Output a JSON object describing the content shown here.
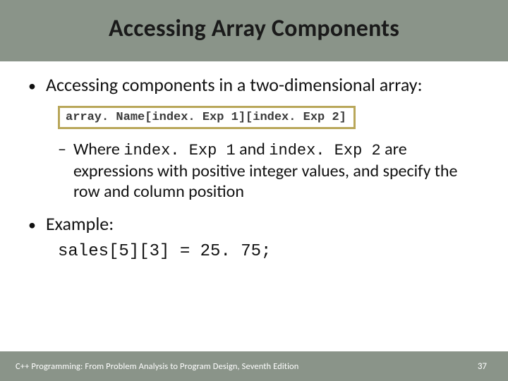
{
  "title": "Accessing Array Components",
  "bullets": {
    "intro": "Accessing components in a two-dimensional array:",
    "syntax": "array. Name[index. Exp 1][index. Exp 2]",
    "sub": {
      "pre": "Where ",
      "code1": "index. Exp 1",
      "mid": " and ",
      "code2": "index. Exp 2",
      "post": " are expressions with positive integer values, and specify the row and column position"
    },
    "exampleLabel": "Example:",
    "exampleCode": "sales[5][3] = 25. 75;"
  },
  "footer": {
    "text": "C++ Programming: From Problem Analysis to Program Design, Seventh Edition",
    "page": "37"
  }
}
